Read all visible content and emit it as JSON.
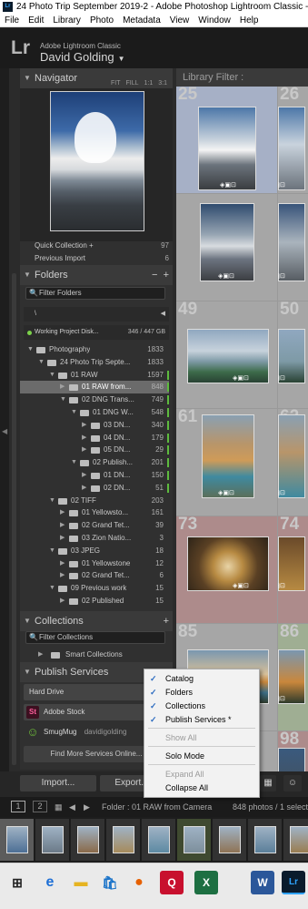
{
  "window": {
    "title": "24 Photo Trip September 2019-2 - Adobe Photoshop Lightroom Classic - Library",
    "app_icon": "Lr"
  },
  "menu": [
    "File",
    "Edit",
    "Library",
    "Photo",
    "Metadata",
    "View",
    "Window",
    "Help"
  ],
  "identity": {
    "logo": "Lr",
    "product": "Adobe Lightroom Classic",
    "user": "David Golding"
  },
  "navigator": {
    "title": "Navigator",
    "modes": [
      "FIT",
      "FILL",
      "1:1",
      "3:1"
    ]
  },
  "catalog": {
    "items": [
      {
        "label": "Quick Collection +",
        "count": "97"
      },
      {
        "label": "Previous Import",
        "count": "6"
      }
    ]
  },
  "folders": {
    "title": "Folders",
    "filter_label": "Filter Folders",
    "root_path": "\\",
    "volume": {
      "label": "Working Project Disk...",
      "size": "346 / 447 GB"
    },
    "tree": [
      {
        "label": "Photography",
        "count": "1833",
        "level": 0,
        "open": true,
        "selected": false,
        "sync": false
      },
      {
        "label": "24 Photo Trip Septe...",
        "count": "1833",
        "level": 1,
        "open": true,
        "selected": false,
        "sync": false
      },
      {
        "label": "01 RAW",
        "count": "1597",
        "level": 2,
        "open": true,
        "selected": false,
        "sync": true
      },
      {
        "label": "01 RAW from...",
        "count": "848",
        "level": 3,
        "open": false,
        "selected": true,
        "sync": true
      },
      {
        "label": "02 DNG Trans...",
        "count": "749",
        "level": 3,
        "open": true,
        "selected": false,
        "sync": true
      },
      {
        "label": "01 DNG W...",
        "count": "548",
        "level": 4,
        "open": true,
        "selected": false,
        "sync": true
      },
      {
        "label": "03 DN...",
        "count": "340",
        "level": 5,
        "open": false,
        "selected": false,
        "sync": true
      },
      {
        "label": "04 DN...",
        "count": "179",
        "level": 5,
        "open": false,
        "selected": false,
        "sync": true
      },
      {
        "label": "05 DN...",
        "count": "29",
        "level": 5,
        "open": false,
        "selected": false,
        "sync": true
      },
      {
        "label": "02 Publish...",
        "count": "201",
        "level": 4,
        "open": true,
        "selected": false,
        "sync": true
      },
      {
        "label": "01 DN...",
        "count": "150",
        "level": 5,
        "open": false,
        "selected": false,
        "sync": true
      },
      {
        "label": "02 DN...",
        "count": "51",
        "level": 5,
        "open": false,
        "selected": false,
        "sync": true
      },
      {
        "label": "02 TIFF",
        "count": "203",
        "level": 2,
        "open": true,
        "selected": false,
        "sync": false
      },
      {
        "label": "01 Yellowsto...",
        "count": "161",
        "level": 3,
        "open": false,
        "selected": false,
        "sync": false
      },
      {
        "label": "02 Grand Tet...",
        "count": "39",
        "level": 3,
        "open": false,
        "selected": false,
        "sync": false
      },
      {
        "label": "03 Zion Natio...",
        "count": "3",
        "level": 3,
        "open": false,
        "selected": false,
        "sync": false
      },
      {
        "label": "03 JPEG",
        "count": "18",
        "level": 2,
        "open": true,
        "selected": false,
        "sync": false
      },
      {
        "label": "01 Yellowstone",
        "count": "12",
        "level": 3,
        "open": false,
        "selected": false,
        "sync": false
      },
      {
        "label": "02 Grand Tet...",
        "count": "6",
        "level": 3,
        "open": false,
        "selected": false,
        "sync": false
      },
      {
        "label": "09 Previous work",
        "count": "15",
        "level": 2,
        "open": true,
        "selected": false,
        "sync": false
      },
      {
        "label": "02 Published",
        "count": "15",
        "level": 3,
        "open": false,
        "selected": false,
        "sync": false
      }
    ]
  },
  "collections": {
    "title": "Collections",
    "filter_label": "Filter Collections",
    "smart": "Smart Collections"
  },
  "publish": {
    "title": "Publish Services",
    "services": [
      {
        "name": "Hard Drive",
        "sub": "",
        "logo": "",
        "logo_color": "#444444"
      },
      {
        "name": "Adobe Stock",
        "sub": "",
        "logo": "St",
        "logo_color": "#3c1020"
      },
      {
        "name": "SmugMug",
        "sub": "davidigolding",
        "logo": "☺",
        "logo_color": "#6fbf3a"
      }
    ],
    "find_more": "Find More Services Online..."
  },
  "context_menu": {
    "items": [
      {
        "label": "Catalog",
        "checked": true,
        "disabled": false
      },
      {
        "label": "Folders",
        "checked": true,
        "disabled": false
      },
      {
        "label": "Collections",
        "checked": true,
        "disabled": false
      },
      {
        "label": "Publish Services *",
        "checked": true,
        "disabled": false
      },
      {
        "label": "Show All",
        "checked": false,
        "disabled": true
      },
      {
        "label": "Solo Mode",
        "checked": false,
        "disabled": false
      },
      {
        "label": "Expand All",
        "checked": false,
        "disabled": true
      },
      {
        "label": "Collapse All",
        "checked": false,
        "disabled": false
      }
    ]
  },
  "grid": {
    "filter_label": "Library Filter :",
    "cells": [
      {
        "num": "25",
        "selected": true
      },
      {
        "num": "26",
        "selected": false
      },
      {
        "num": "",
        "selected": false
      },
      {
        "num": "",
        "selected": false
      },
      {
        "num": "49",
        "selected": false
      },
      {
        "num": "50",
        "selected": false
      },
      {
        "num": "61",
        "selected": false
      },
      {
        "num": "62",
        "selected": false
      },
      {
        "num": "73",
        "selected": false
      },
      {
        "num": "74",
        "selected": false
      },
      {
        "num": "85",
        "selected": false
      },
      {
        "num": "86",
        "selected": false
      },
      {
        "num": "97",
        "selected": false
      },
      {
        "num": "98",
        "selected": false
      }
    ]
  },
  "buttons": {
    "import": "Import...",
    "export": "Export..."
  },
  "filmstrip_bar": {
    "pages": [
      "1",
      "2"
    ],
    "source": "Folder : 01 RAW from Camera",
    "summary": "848 photos / 1 selected"
  },
  "taskbar": [
    "windows",
    "edge",
    "explorer",
    "store",
    "firefox",
    "quicken",
    "excel",
    "word",
    "lightroom"
  ]
}
